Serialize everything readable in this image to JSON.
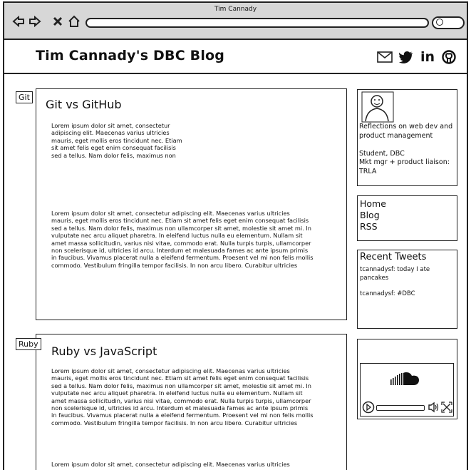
{
  "window": {
    "title": "Tim Cannady"
  },
  "site": {
    "title": "Tim Cannady's DBC Blog"
  },
  "social": {
    "icons": [
      "mail-icon",
      "twitter-icon",
      "linkedin-icon",
      "github-icon"
    ],
    "linkedin_text": "in"
  },
  "posts": [
    {
      "tag": "Git",
      "title": "Git vs GitHub",
      "excerpt": [
        "Lorem ipsum dolor sit amet, consectetur",
        "adipiscing elit. Maecenas varius ultricies",
        "mauris, eget mollis eros tincidunt nec. Etiam",
        "sit amet felis eget enim consequat facilisis",
        "sed a tellus. Nam dolor felis, maximus non"
      ],
      "body": [
        "Lorem ipsum dolor sit amet, consectetur adipiscing elit. Maecenas varius ultricies",
        "mauris, eget mollis eros tincidunt nec. Etiam sit amet felis eget enim consequat facilisis",
        "sed a tellus. Nam dolor felis, maximus non ullamcorper sit amet, molestie sit amet mi. In",
        "vulputate nec arcu aliquet pharetra. In eleifend luctus nulla eu elementum. Nullam sit",
        "amet massa sollicitudin, varius nisi vitae, commodo erat. Nulla turpis turpis, ullamcorper",
        "non scelerisque id, ultricies id arcu. Interdum et malesuada fames ac ante ipsum primis",
        "in faucibus. Vivamus placerat nulla a eleifend fermentum. Proesent vel mi non felis mollis",
        "commodo. Vestibulum fringilla tempor facilisis. In non arcu libero. Curabitur ultricies"
      ]
    },
    {
      "tag": "Ruby",
      "title": "Ruby vs JavaScript",
      "body": [
        "Lorem ipsum dolor sit amet, consectetur adipiscing elit. Maecenas varius ultricies",
        "mauris, eget mollis eros tincidunt nec. Etiam sit amet felis eget enim consequat facilisis",
        "sed a tellus. Nam dolor felis, maximus non ullamcorper sit amet, molestie sit amet mi. In",
        "vulputate nec arcu aliquet pharetra. In eleifend luctus nulla eu elementum. Nullam sit",
        "amet massa sollicitudin, varius nisi vitae, commodo erat. Nulla turpis turpis, ullamcorper",
        "non scelerisque id, ultricies id arcu. Interdum et malesuada fames ac ante ipsum primis",
        "in faucibus. Vivamus placerat nulla a eleifend fermentum. Proesent vel mi non felis mollis",
        "commodo. Vestibulum fringilla tempor facilisis. In non arcu libero. Curabitur ultricies"
      ],
      "body2_first_line": "Lorem ipsum dolor sit amet, consectetur adipiscing elit. Maecenas varius ultricies"
    }
  ],
  "sidebar": {
    "bio": [
      "Reflections on web dev and",
      "product management",
      "",
      "Student, DBC",
      "Mkt mgr + product liaison:",
      "TRLA"
    ],
    "nav": [
      "Home",
      "Blog",
      "RSS"
    ],
    "tweets": {
      "title": "Recent Tweets",
      "items": [
        [
          "tcannadysf: today I ate",
          "pancakes"
        ],
        [
          "tcannadysf: #DBC"
        ]
      ]
    },
    "player": {
      "icons": [
        "soundcloud-icon",
        "play-icon",
        "volume-icon",
        "fullscreen-icon"
      ]
    }
  }
}
